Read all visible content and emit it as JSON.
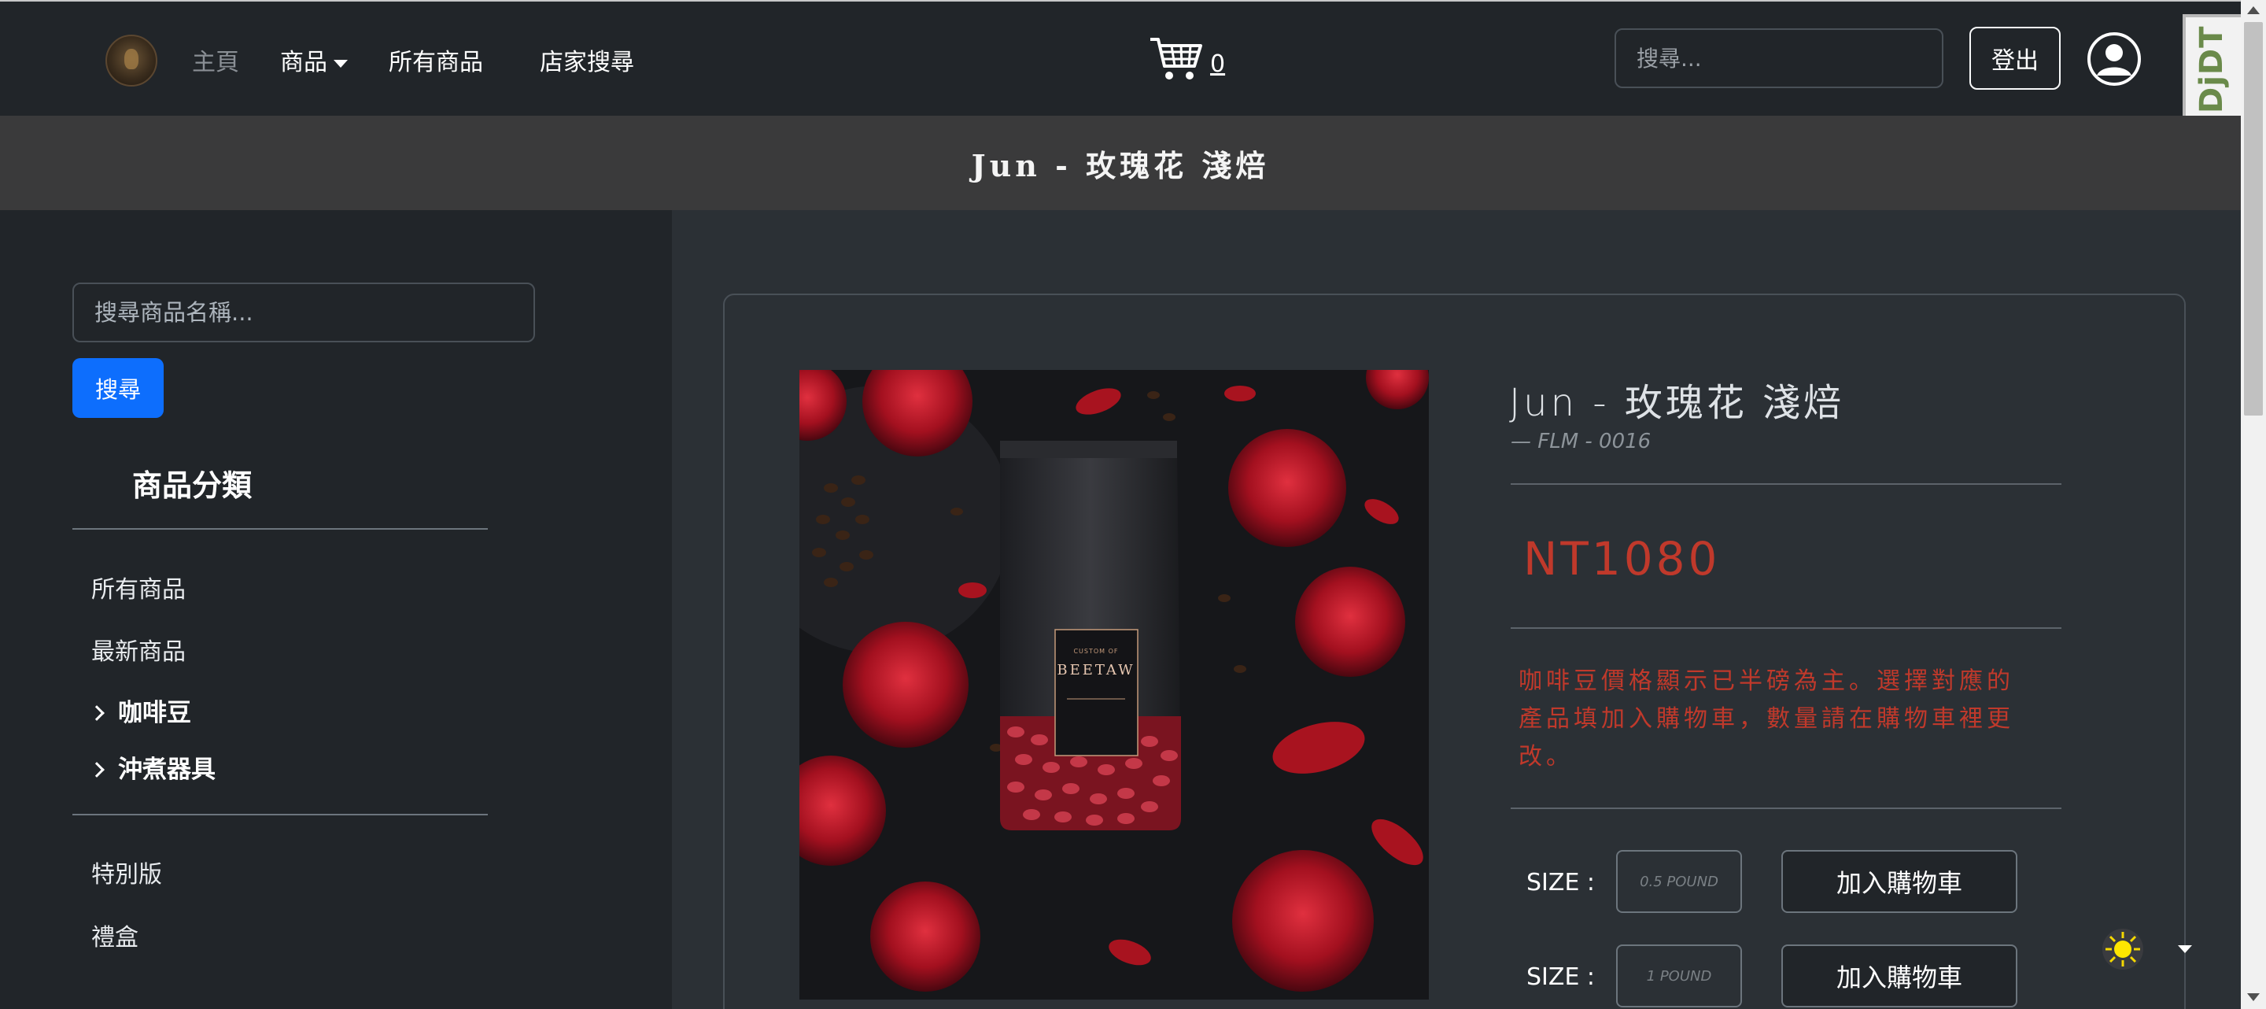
{
  "navbar": {
    "home": "主頁",
    "products": "商品",
    "all_products": "所有商品",
    "store_search": "店家搜尋",
    "cart_count": "0",
    "search_placeholder": "搜尋...",
    "logout": "登出",
    "debug_toolbar": "DjDT"
  },
  "page": {
    "title": "Jun - 玫瑰花 淺焙"
  },
  "sidebar": {
    "search_placeholder": "搜尋商品名稱...",
    "search_button": "搜尋",
    "heading": "商品分類",
    "links": [
      "所有商品",
      "最新商品"
    ],
    "categories": [
      "咖啡豆",
      "沖煮器具"
    ],
    "extra_links": [
      "特別版",
      "禮盒"
    ]
  },
  "product": {
    "name": "Jun - 玫瑰花 淺焙",
    "sku": "—  FLM - 0016",
    "price": "NT1080",
    "note": "咖啡豆價格顯示已半磅為主。選擇對應的產品填加入購物車，數量請在購物車裡更改。",
    "image_bag_brand": "BEETAW",
    "image_bag_tag": "CUSTOM OF",
    "sizes": [
      {
        "label": "SIZE :",
        "value": "0.5 POUND",
        "button": "加入購物車"
      },
      {
        "label": "SIZE :",
        "value": "1 POUND",
        "button": "加入購物車"
      }
    ]
  },
  "colors": {
    "navbar_bg": "#212529",
    "page_bg": "#2b3035",
    "title_bar_bg": "#3a3a3b",
    "primary": "#0d6efd",
    "price_red": "#c0392b"
  },
  "icons": {
    "cart": "cart-icon",
    "user": "user-circle-icon",
    "theme": "sun-icon",
    "chevron": "chevron-right-icon"
  }
}
